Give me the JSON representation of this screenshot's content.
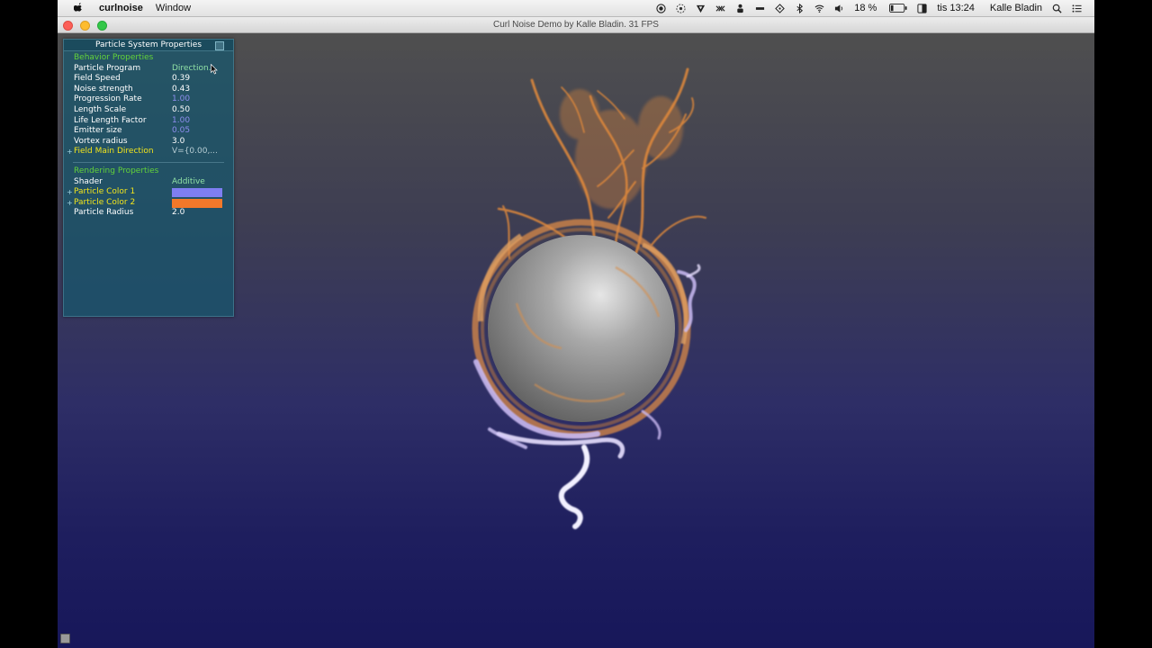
{
  "menubar": {
    "app_name": "curlnoise",
    "menus": [
      "Window"
    ],
    "battery": "18 %",
    "clock": "tis 13:24",
    "user": "Kalle Bladin"
  },
  "window": {
    "title": "Curl Noise Demo by Kalle Bladin. 31 FPS"
  },
  "panel": {
    "title": "Particle System Properties",
    "behavior": {
      "heading": "Behavior Properties",
      "rows": [
        {
          "label": "Particle Program",
          "value": "Direction..."
        },
        {
          "label": "Field Speed",
          "value": "0.39"
        },
        {
          "label": "Noise strength",
          "value": "0.43"
        },
        {
          "label": "Progression Rate",
          "value": "1.00"
        },
        {
          "label": "Length Scale",
          "value": "0.50"
        },
        {
          "label": "Life Length Factor",
          "value": "1.00"
        },
        {
          "label": "Emitter size",
          "value": "0.05"
        },
        {
          "label": "Vortex radius",
          "value": "3.0"
        },
        {
          "label": "Field Main Direction",
          "value": "V={0.00,..."
        }
      ]
    },
    "rendering": {
      "heading": "Rendering Properties",
      "shader_label": "Shader",
      "shader_value": "Additive",
      "color1_label": "Particle Color 1",
      "color1": "#7e7ef2",
      "color2_label": "Particle Color 2",
      "color2": "#f2782a",
      "radius_label": "Particle Radius",
      "radius_value": "2.0"
    }
  },
  "colors": {
    "menubar_bg": "#e9e9e9",
    "viewport_top": "#4f4f4f",
    "viewport_bottom": "#17175a",
    "panel_bg": "#16586e",
    "section_heading": "#63d23a",
    "highlight_label": "#f2e41c"
  }
}
